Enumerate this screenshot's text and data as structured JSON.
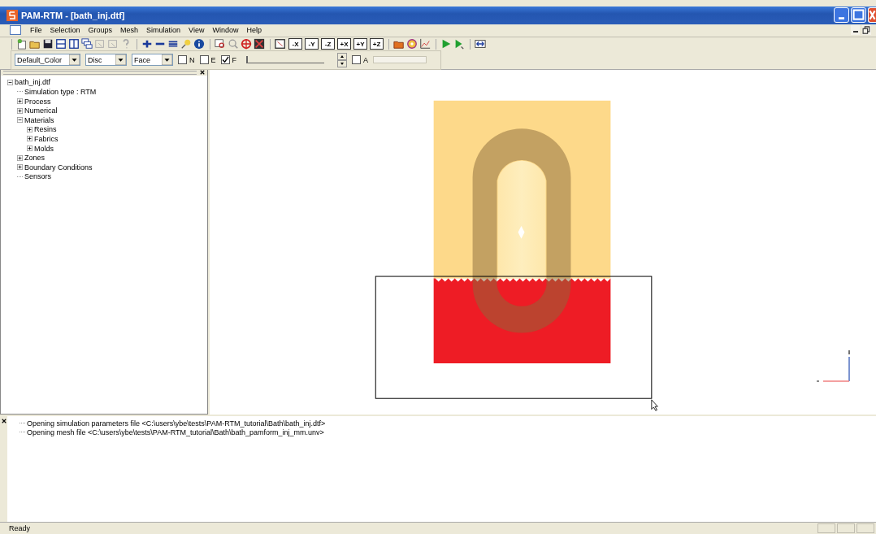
{
  "window": {
    "title": "PAM-RTM - [bath_inj.dtf]"
  },
  "menu": [
    "File",
    "Selection",
    "Groups",
    "Mesh",
    "Simulation",
    "View",
    "Window",
    "Help"
  ],
  "view_buttons": [
    "-X",
    "-Y",
    "-Z",
    "+X",
    "+Y",
    "+Z"
  ],
  "display_bar": {
    "dropdowns": [
      "Default_Color",
      "Disc",
      "Face"
    ],
    "checkboxes": [
      {
        "label": "N",
        "checked": false
      },
      {
        "label": "E",
        "checked": false
      },
      {
        "label": "F",
        "checked": true
      }
    ],
    "slider": {
      "level": 0.0
    },
    "checkbox_a": {
      "label": "A",
      "checked": false
    }
  },
  "tree": [
    {
      "label": "bath_inj.dtf",
      "expanded": true,
      "children": [
        {
          "label": "Simulation type : RTM"
        },
        {
          "label": "Process",
          "expanded": false
        },
        {
          "label": "Numerical",
          "expanded": false
        },
        {
          "label": "Materials",
          "expanded": true,
          "children": [
            {
              "label": "Resins",
              "expanded": false
            },
            {
              "label": "Fabrics",
              "expanded": false
            },
            {
              "label": "Molds",
              "expanded": false
            }
          ]
        },
        {
          "label": "Zones",
          "expanded": false
        },
        {
          "label": "Boundary Conditions",
          "expanded": false
        },
        {
          "label": "Sensors"
        }
      ]
    }
  ],
  "log": [
    "Opening simulation parameters file <C:\\users\\ybe\\tests\\PAM-RTM_tutorial\\Bath\\bath_inj.dtf>",
    "Opening mesh file <C:\\users\\ybe\\tests\\PAM-RTM_tutorial\\Bath\\bath_pamform_inj_mm.unv>"
  ],
  "status_bar": {
    "text": "Ready"
  }
}
